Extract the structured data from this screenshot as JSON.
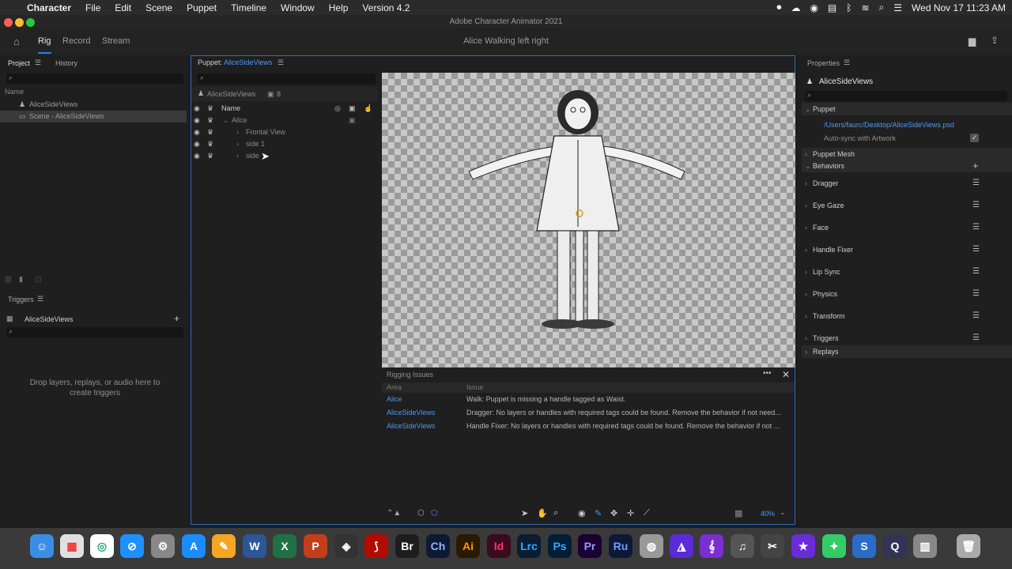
{
  "menubar": {
    "app": "Character",
    "items": [
      "File",
      "Edit",
      "Scene",
      "Puppet",
      "Timeline",
      "Window",
      "Help",
      "Version 4.2"
    ],
    "clock": "Wed Nov 17  11:23 AM"
  },
  "window": {
    "title": "Adobe Character Animator 2021"
  },
  "header": {
    "tabs": [
      "Rig",
      "Record",
      "Stream"
    ],
    "scene_title": "Alice Walking left right"
  },
  "project": {
    "tab_project": "Project",
    "tab_history": "History",
    "col_name": "Name",
    "items": [
      "AliceSideViews",
      "Scene - AliceSideViews"
    ]
  },
  "triggers": {
    "title": "Triggers",
    "puppet": "AliceSideViews",
    "empty_text_1": "Drop layers, replays, or audio here to",
    "empty_text_2": "create triggers"
  },
  "puppet_panel": {
    "label": "Puppet:",
    "name": "AliceSideViews",
    "header_name": "AliceSideViews",
    "count": "8",
    "col_name": "Name",
    "layers": [
      "Alice",
      "Frontal View",
      "side 1",
      "side"
    ]
  },
  "rigging": {
    "title": "Rigging Issues",
    "col_area": "Area",
    "col_issue": "Issue",
    "rows": [
      {
        "area": "Alice",
        "issue": "Walk: Puppet is missing a handle tagged as Waist."
      },
      {
        "area": "AliceSideViews",
        "issue": "Dragger: No layers or handles with required tags could be found. Remove the behavior if not need..."
      },
      {
        "area": "AliceSideViews",
        "issue": "Handle Fixer: No layers or handles with required tags could be found. Remove the behavior if not ..."
      }
    ]
  },
  "toolbar": {
    "zoom": "40%"
  },
  "properties": {
    "title": "Properties",
    "puppet_name": "AliceSideViews",
    "section_puppet": "Puppet",
    "file_path": "/Users/faurc/Desktop/AliceSideViews.psd",
    "autosync": "Auto-sync with Artwork",
    "section_mesh": "Puppet Mesh",
    "section_behaviors": "Behaviors",
    "behaviors": [
      "Dragger",
      "Eye Gaze",
      "Face",
      "Handle Fixer",
      "Lip Sync",
      "Physics",
      "Transform",
      "Triggers"
    ],
    "section_replays": "Replays"
  },
  "dock": {
    "apps": [
      "Br",
      "Ch",
      "Ai",
      "Id",
      "Lrc",
      "Ps",
      "Pr",
      "Ru"
    ],
    "colors": {
      "Br": "#1d1d1d",
      "Ch": "#0c1a33",
      "Ai": "#2a1a00",
      "Id": "#3a0a1f",
      "Lrc": "#0b1d33",
      "Ps": "#001e36",
      "Pr": "#1a0033",
      "Ru": "#0d1a36"
    }
  }
}
